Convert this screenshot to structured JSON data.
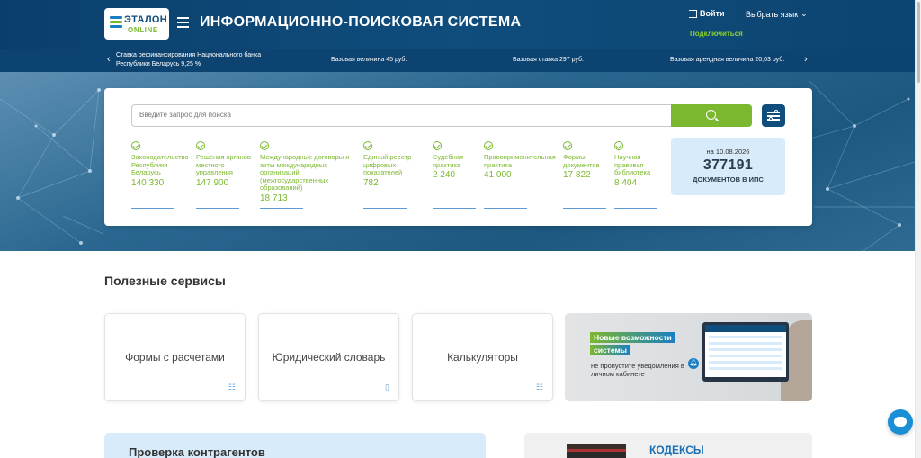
{
  "header": {
    "logo_line1": "ЭТАЛОН",
    "logo_line2": "ONLINE",
    "title": "ИНФОРМАЦИОННО-ПОИСКОВАЯ СИСТЕМА",
    "login_label": "Войти",
    "language_label": "Выбрать язык",
    "connect_label": "Подключиться"
  },
  "ticker": {
    "items": [
      "Ставка рефинансирования Национального банка Республики Беларусь 9,25 %",
      "Базовая величина 45 руб.",
      "Базовая ставка 297 руб.",
      "Базовая арендная величина 20,03 руб."
    ]
  },
  "search": {
    "placeholder": "Введите запрос для поиска"
  },
  "categories": [
    {
      "label": "Законодательство Республики Беларусь",
      "count": "140 330"
    },
    {
      "label": "Решения органов местного управления",
      "count": "147 900"
    },
    {
      "label": "Международные договоры и акты международных организаций (межгосударственных образований)",
      "count": "18 713"
    },
    {
      "label": "Единый реестр цифровых показателей",
      "count": "782"
    },
    {
      "label": "Судебная практика",
      "count": "2 240"
    },
    {
      "label": "Правоприменительная практика",
      "count": "41 000"
    },
    {
      "label": "Формы документов",
      "count": "17 822"
    },
    {
      "label": "Научная правовая библиотека",
      "count": "8 404"
    }
  ],
  "docs_counter": {
    "date": "на 10.08.2026",
    "count": "377191",
    "label": "ДОКУМЕНТОВ В ИПС"
  },
  "services": {
    "title": "Полезные сервисы",
    "items": [
      {
        "label": "Формы с расчетами",
        "icon": "list-icon"
      },
      {
        "label": "Юридический словарь",
        "icon": "book-icon"
      },
      {
        "label": "Калькуляторы",
        "icon": "list-icon"
      }
    ],
    "promo": {
      "line1": "Новые возможности",
      "line2": "системы",
      "sub": "не пропустите уведомления в личном кабинете"
    }
  },
  "bottom": {
    "left_title": "Проверка контрагентов",
    "right_title": "КОДЕКСЫ"
  },
  "colors": {
    "brand_blue": "#0f4d7d",
    "accent_green": "#7cb82f",
    "light_blue": "#d8ebfa"
  }
}
